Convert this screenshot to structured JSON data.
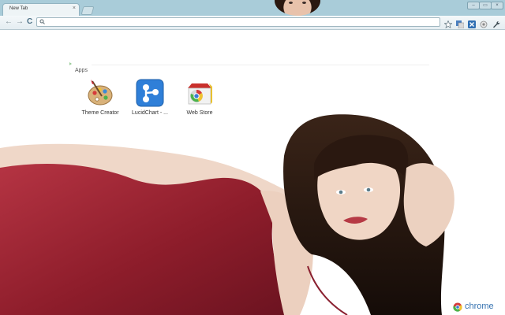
{
  "browser": {
    "tab": {
      "title": "New Tab",
      "close_glyph": "×"
    },
    "window_controls": {
      "minimize": "–",
      "maximize": "▭",
      "close": "×"
    },
    "nav": {
      "back": "←",
      "forward": "→",
      "reload": "C"
    },
    "omnibox": {
      "value": "",
      "search_icon": "search-icon"
    },
    "toolbar_icons": [
      "star-icon",
      "translate-icon",
      "extension-icon",
      "circle-icon",
      "wrench-icon"
    ]
  },
  "apps": {
    "heading": "Apps",
    "items": [
      {
        "label": "Theme Creator",
        "icon": "palette-icon"
      },
      {
        "label": "LucidChart - ...",
        "icon": "lucidchart-icon"
      },
      {
        "label": "Web Store",
        "icon": "webstore-icon"
      }
    ]
  },
  "branding": {
    "wordmark": "chrome"
  },
  "colors": {
    "titlebar": "#a9ccd9",
    "dress": "#9e2431",
    "hair": "#2a1810",
    "chrome_blue": "#3572b0"
  }
}
